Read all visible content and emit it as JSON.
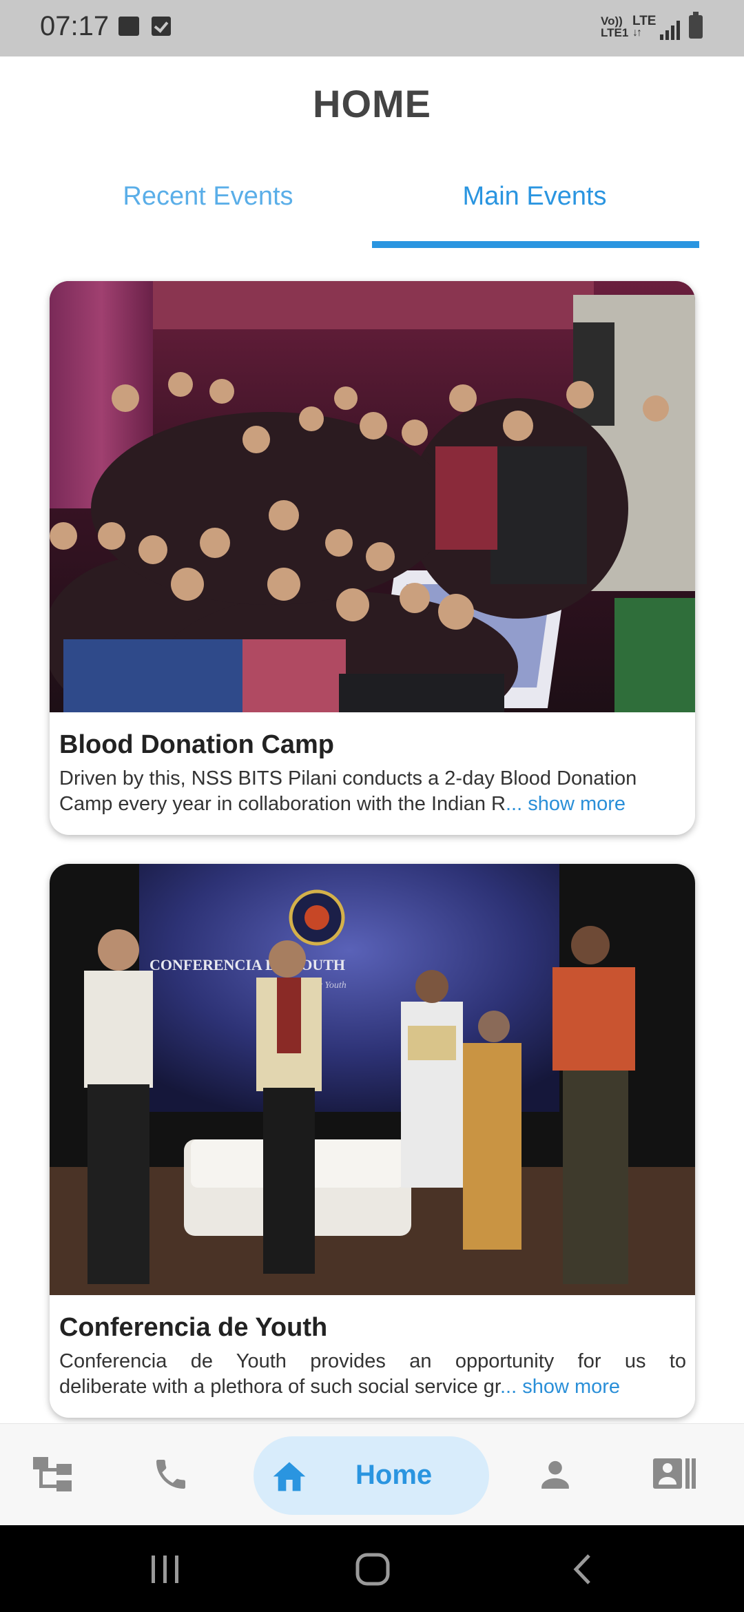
{
  "status_bar": {
    "time": "07:17",
    "icons": [
      "image-icon",
      "checkbox-icon",
      "volte-icon",
      "lte-icon",
      "signal-icon",
      "battery-icon"
    ],
    "volte_line1": "Vo))",
    "volte_line2": "LTE1",
    "network": "LTE"
  },
  "header": {
    "title": "HOME"
  },
  "tabs": [
    {
      "label": "Recent Events",
      "active": false
    },
    {
      "label": "Main Events",
      "active": true
    }
  ],
  "events": [
    {
      "title": "Blood Donation Camp",
      "desc_line1": "Driven by this, NSS BITS Pilani conducts a 2-day Blood Donation",
      "desc_line2": "Camp every year in collaboration with the Indian R",
      "show_more": "... show more"
    },
    {
      "title": "Conferencia de Youth",
      "desc_line1": "Conferencia de Youth provides an opportunity for us to",
      "desc_line2": "deliberate with a plethora of such social service gr",
      "show_more": "... show more",
      "image_text": "CONFERENCIA DE YOUTH",
      "image_subtext": "Conference for Youth"
    }
  ],
  "bottom_nav": {
    "items": [
      {
        "icon": "hierarchy-icon"
      },
      {
        "icon": "phone-icon"
      },
      {
        "icon": "home-icon",
        "label": "Home",
        "active": true
      },
      {
        "icon": "person-icon"
      },
      {
        "icon": "contact-card-icon"
      }
    ]
  },
  "colors": {
    "accent": "#2a95e0",
    "accent_light": "#5aaee8",
    "pill": "#d8ecfb",
    "status_bar": "#c8c8c8"
  }
}
